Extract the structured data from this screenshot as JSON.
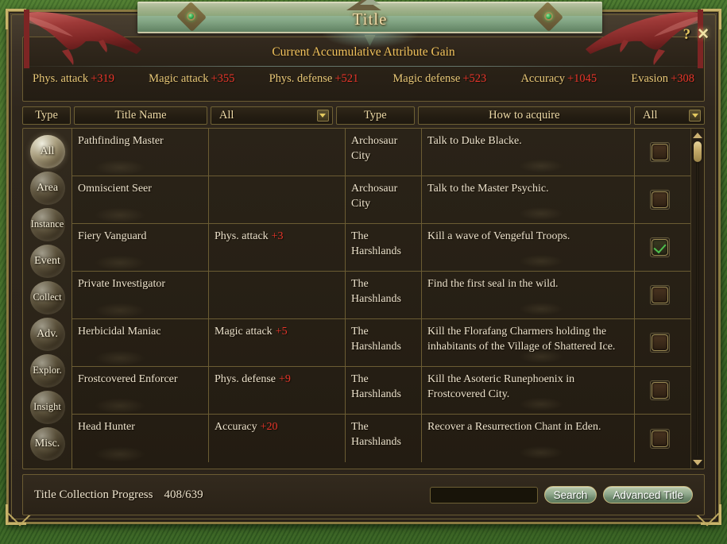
{
  "window": {
    "title": "Title",
    "help_icon": "?",
    "close_icon": "✕"
  },
  "attribute_panel": {
    "heading": "Current Accumulative Attribute Gain",
    "stats": [
      {
        "label": "Phys. attack",
        "value": "+319"
      },
      {
        "label": "Magic attack",
        "value": "+355"
      },
      {
        "label": "Phys. defense",
        "value": "+521"
      },
      {
        "label": "Magic defense",
        "value": "+523"
      },
      {
        "label": "Accuracy",
        "value": "+1045"
      },
      {
        "label": "Evasion",
        "value": "+308"
      }
    ]
  },
  "column_headers": {
    "type_left": "Type",
    "title_name": "Title Name",
    "filter_left": "All",
    "type_right": "Type",
    "how_to_acquire": "How to acquire",
    "filter_right": "All"
  },
  "sidebar": {
    "items": [
      {
        "label": "All",
        "active": true,
        "small": false
      },
      {
        "label": "Area",
        "active": false,
        "small": false
      },
      {
        "label": "Instance",
        "active": false,
        "small": true
      },
      {
        "label": "Event",
        "active": false,
        "small": false
      },
      {
        "label": "Collect",
        "active": false,
        "small": true
      },
      {
        "label": "Adv.",
        "active": false,
        "small": false
      },
      {
        "label": "Explor.",
        "active": false,
        "small": true
      },
      {
        "label": "Insight",
        "active": false,
        "small": true
      },
      {
        "label": "Misc.",
        "active": false,
        "small": false
      }
    ]
  },
  "table": {
    "rows": [
      {
        "name": "Pathfinding Master",
        "attr_label": "",
        "attr_value": "",
        "type": "Archosaur City",
        "how_to": "Talk to Duke Blacke.",
        "checked": false
      },
      {
        "name": "Omniscient Seer",
        "attr_label": "",
        "attr_value": "",
        "type": "Archosaur City",
        "how_to": "Talk to the Master Psychic.",
        "checked": false
      },
      {
        "name": "Fiery Vanguard",
        "attr_label": "Phys. attack",
        "attr_value": "+3",
        "type": "The Harshlands",
        "how_to": "Kill a wave of Vengeful Troops.",
        "checked": true
      },
      {
        "name": "Private Investigator",
        "attr_label": "",
        "attr_value": "",
        "type": "The Harshlands",
        "how_to": "Find the first seal in the wild.",
        "checked": false
      },
      {
        "name": "Herbicidal Maniac",
        "attr_label": "Magic attack",
        "attr_value": "+5",
        "type": "The Harshlands",
        "how_to": "Kill the Florafang Charmers holding the inhabitants of the Village of Shattered Ice.",
        "checked": false
      },
      {
        "name": "Frostcovered Enforcer",
        "attr_label": "Phys. defense",
        "attr_value": "+9",
        "type": "The Harshlands",
        "how_to": "Kill the Asoteric Runephoenix in Frostcovered City.",
        "checked": false
      },
      {
        "name": "Head Hunter",
        "attr_label": "Accuracy",
        "attr_value": "+20",
        "type": "The Harshlands",
        "how_to": "Recover a Resurrection Chant in Eden.",
        "checked": false
      }
    ]
  },
  "footer": {
    "progress_label": "Title Collection Progress",
    "progress_value": "408/639",
    "search_value": "",
    "search_placeholder": "",
    "search_button": "Search",
    "advanced_button": "Advanced Title"
  },
  "colors": {
    "gold_text": "#e8c878",
    "red_value": "#e8352b",
    "title_gold": "#efd9a7",
    "heading_gold": "#f0c25c",
    "check_green": "#4ec24e",
    "frame_border": "#8a7a42"
  }
}
